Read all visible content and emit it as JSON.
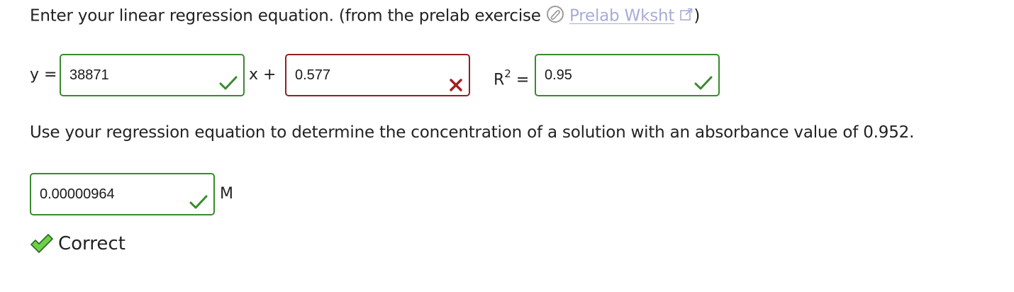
{
  "question1": {
    "prompt": "Enter your linear regression equation. (from the prelab exercise",
    "link_label": "Prelab Wksht",
    "closing": ")"
  },
  "equation": {
    "y_label": "y =",
    "slope_value": "38871",
    "slope_status": "correct",
    "x_plus_label": "x +",
    "intercept_value": "0.577",
    "intercept_status": "incorrect",
    "r2_base": "R",
    "r2_exp": "2",
    "r2_equals": "=",
    "r2_value": "0.95",
    "r2_status": "correct"
  },
  "question2": {
    "prompt": "Use your regression equation to determine the concentration of a solution with an absorbance value of 0.952."
  },
  "answer": {
    "value": "0.00000964",
    "status": "correct",
    "unit": "M"
  },
  "feedback": {
    "label": "Correct"
  },
  "colors": {
    "correct": "#3a8a2f",
    "incorrect": "#8f2222",
    "link": "#a9acd6"
  }
}
